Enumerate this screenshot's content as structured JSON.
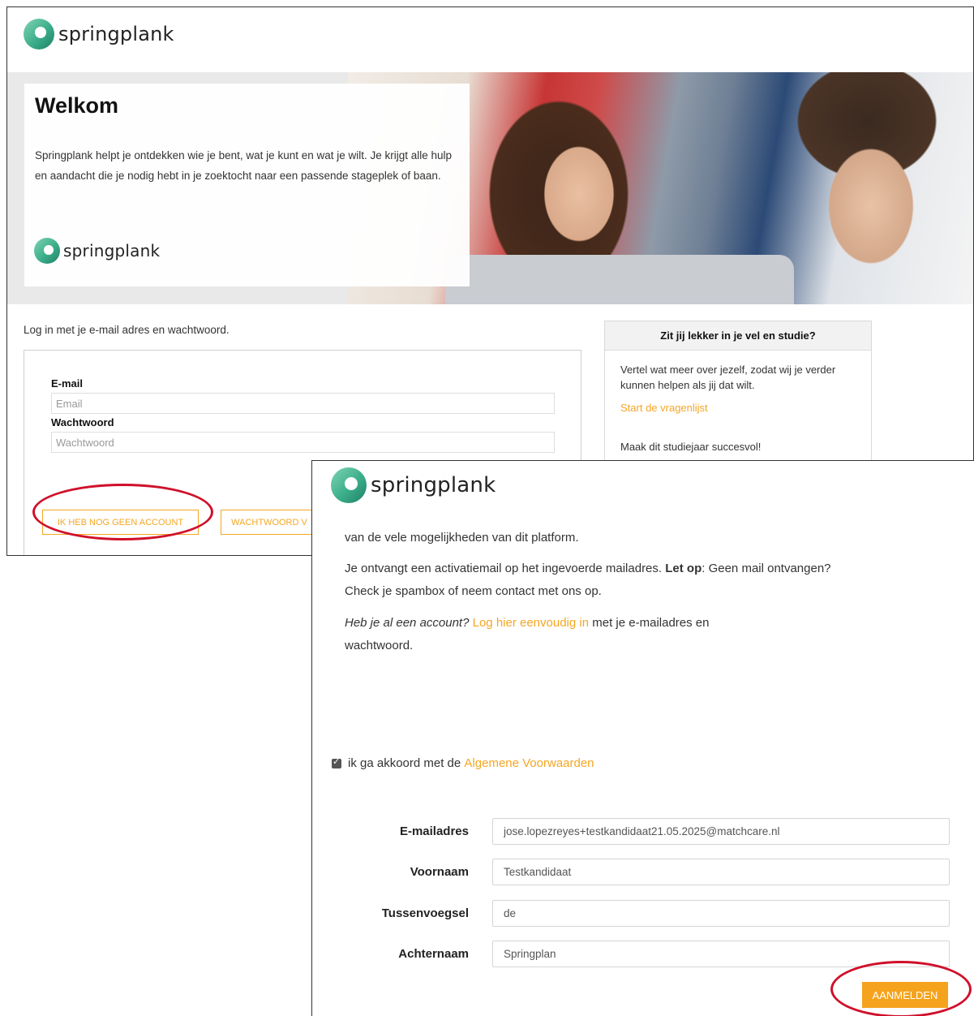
{
  "brand": {
    "name": "springplank",
    "accent": "#f5a623",
    "logo_icon": "springplank-logo-icon"
  },
  "login_page": {
    "hero": {
      "title": "Welkom",
      "text": "Springplank helpt je ontdekken wie je bent, wat je kunt en wat je wilt. Je krijgt alle hulp en aandacht die je nodig hebt in je zoektocht naar een passende stageplek of baan."
    },
    "intro": "Log in met je e-mail adres en wachtwoord.",
    "email_label": "E-mail",
    "email_placeholder": "Email",
    "password_label": "Wachtwoord",
    "password_placeholder": "Wachtwoord",
    "no_account_button": "IK HEB NOG GEEN ACCOUNT",
    "forgot_password_button": "WACHTWOORD V",
    "side_card": {
      "title": "Zit jij lekker in je vel en studie?",
      "text": "Vertel wat meer over jezelf, zodat wij je verder kunnen helpen als jij dat wilt.",
      "link": "Start de vragenlijst",
      "footer": "Maak dit studiejaar succesvol!"
    }
  },
  "register_page": {
    "line1": "van de vele mogelijkheden van dit platform.",
    "activation_prefix": "Je ontvangt een activatiemail op het ingevoerde mailadres.",
    "activation_bold": "Let op",
    "activation_suffix": ": Geen mail ontvangen? Check je spambox of neem contact met ons op.",
    "account_question": "Heb je al een account?",
    "account_link": "Log hier eenvoudig in",
    "account_suffix": "met je e-mailadres en wachtwoord.",
    "terms_prefix": "ik ga akkoord met de",
    "terms_link": "Algemene Voorwaarden",
    "terms_checked": true,
    "fields": [
      {
        "label": "E-mailadres",
        "value": "jose.lopezreyes+testkandidaat21.05.2025@matchcare.nl"
      },
      {
        "label": "Voornaam",
        "value": "Testkandidaat"
      },
      {
        "label": "Tussenvoegsel",
        "value": "de"
      },
      {
        "label": "Achternaam",
        "value": "Springplan"
      }
    ],
    "submit_button": "AANMELDEN"
  },
  "annotations": {
    "highlight_color": "#d0102a"
  }
}
